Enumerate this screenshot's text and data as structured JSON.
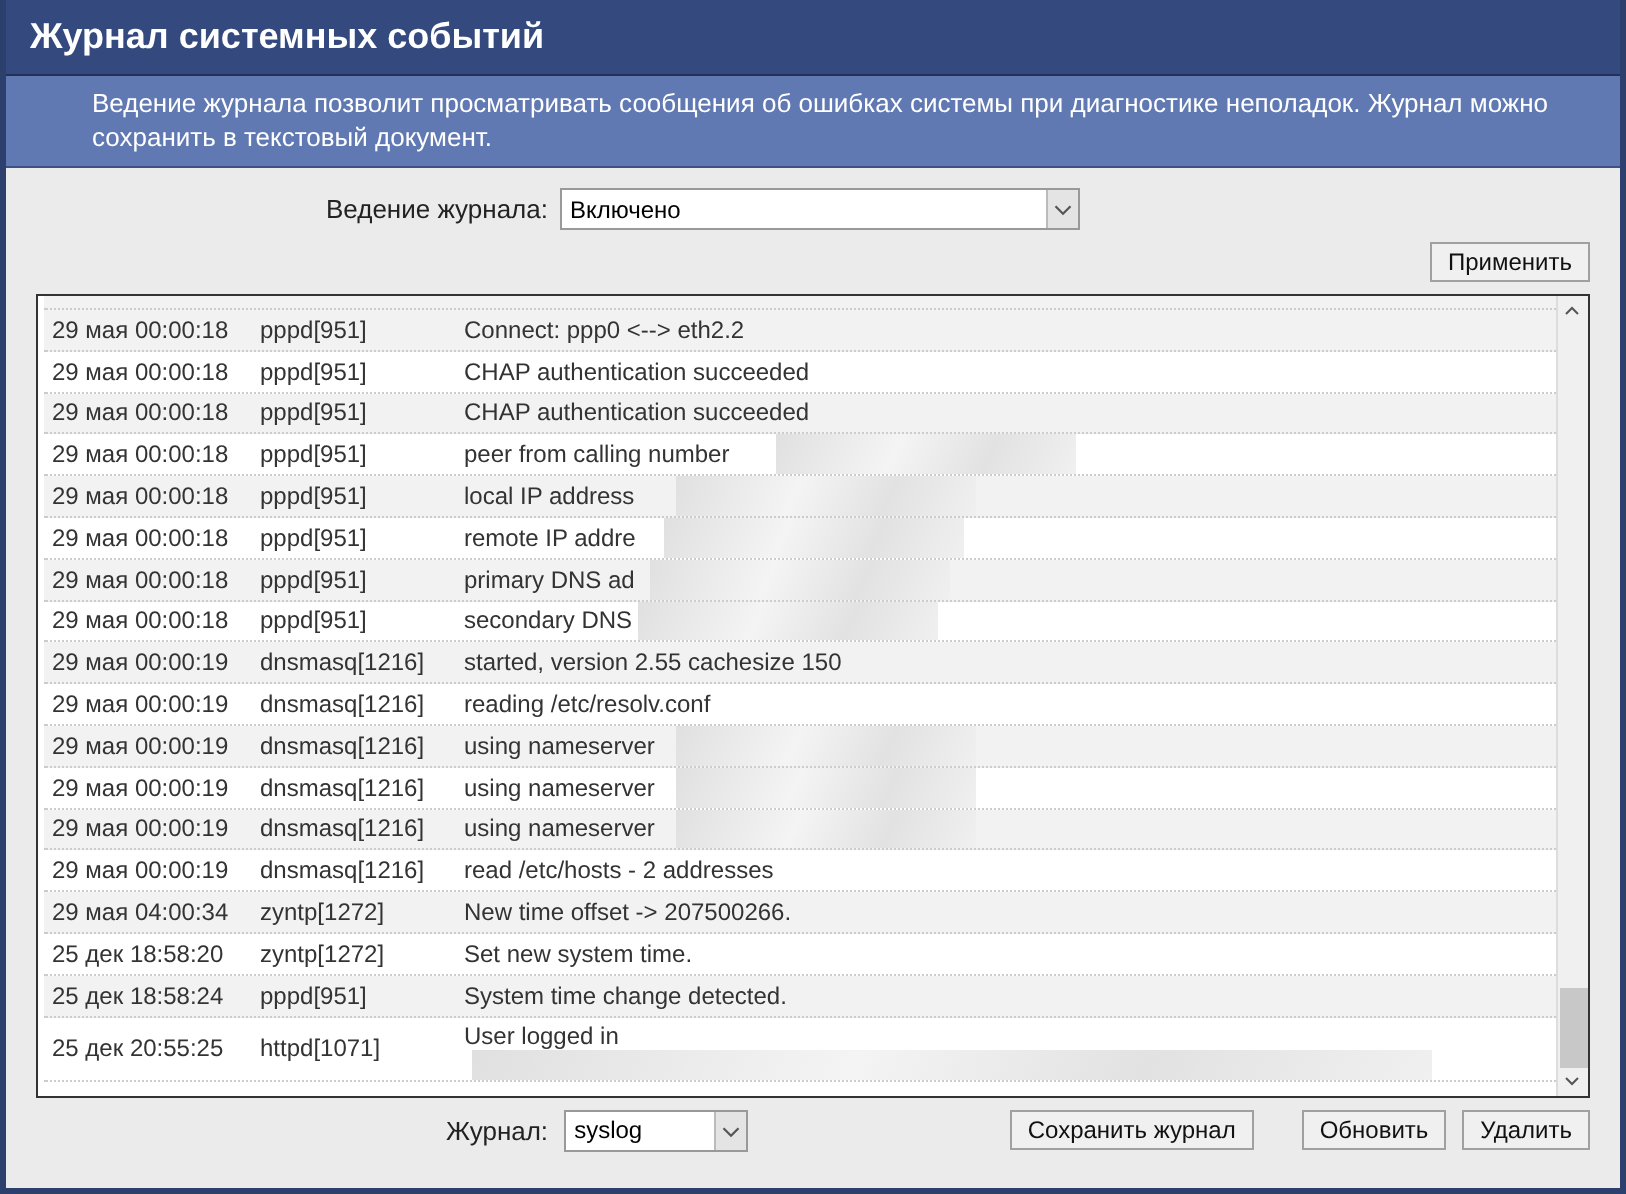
{
  "window": {
    "title": "Журнал системных событий",
    "description": "Ведение журнала позволит просматривать сообщения об ошибках системы при диагностике неполадок. Журнал можно сохранить в текстовый документ."
  },
  "logging": {
    "label": "Ведение журнала:",
    "value": "Включено"
  },
  "apply_button": "Применить",
  "log": {
    "rows": [
      {
        "date": "29 мая 00:00:18",
        "process": "pppd[951]",
        "message": "Connect: ppp0 <--> eth2.2",
        "redacted": false
      },
      {
        "date": "29 мая 00:00:18",
        "process": "pppd[951]",
        "message": "CHAP authentication succeeded",
        "redacted": false
      },
      {
        "date": "29 мая 00:00:18",
        "process": "pppd[951]",
        "message": "CHAP authentication succeeded",
        "redacted": false
      },
      {
        "date": "29 мая 00:00:18",
        "process": "pppd[951]",
        "message": "peer from calling number",
        "redacted": true
      },
      {
        "date": "29 мая 00:00:18",
        "process": "pppd[951]",
        "message": "local IP address",
        "redacted": true
      },
      {
        "date": "29 мая 00:00:18",
        "process": "pppd[951]",
        "message": "remote IP addre",
        "redacted": true
      },
      {
        "date": "29 мая 00:00:18",
        "process": "pppd[951]",
        "message": "primary DNS ad",
        "redacted": true
      },
      {
        "date": "29 мая 00:00:18",
        "process": "pppd[951]",
        "message": "secondary DNS",
        "redacted": true
      },
      {
        "date": "29 мая 00:00:19",
        "process": "dnsmasq[1216]",
        "message": "started, version 2.55 cachesize 150",
        "redacted": false
      },
      {
        "date": "29 мая 00:00:19",
        "process": "dnsmasq[1216]",
        "message": "reading /etc/resolv.conf",
        "redacted": false
      },
      {
        "date": "29 мая 00:00:19",
        "process": "dnsmasq[1216]",
        "message": "using nameserver",
        "redacted": true
      },
      {
        "date": "29 мая 00:00:19",
        "process": "dnsmasq[1216]",
        "message": "using nameserver",
        "redacted": true
      },
      {
        "date": "29 мая 00:00:19",
        "process": "dnsmasq[1216]",
        "message": "using nameserver",
        "redacted": true
      },
      {
        "date": "29 мая 00:00:19",
        "process": "dnsmasq[1216]",
        "message": "read /etc/hosts - 2 addresses",
        "redacted": false
      },
      {
        "date": "29 мая 04:00:34",
        "process": "zyntp[1272]",
        "message": "New time offset -> 207500266.",
        "redacted": false
      },
      {
        "date": "25 дек 18:58:20",
        "process": "zyntp[1272]",
        "message": "Set new system time.",
        "redacted": false
      },
      {
        "date": "25 дек 18:58:24",
        "process": "pppd[951]",
        "message": "System time change detected.",
        "redacted": false
      },
      {
        "date": "25 дек 20:55:25",
        "process": "httpd[1071]",
        "message": "User logged in",
        "redacted": true
      }
    ]
  },
  "journal": {
    "label": "Журнал:",
    "value": "syslog"
  },
  "buttons": [
    "Сохранить журнал",
    "Обновить",
    "Удалить"
  ]
}
